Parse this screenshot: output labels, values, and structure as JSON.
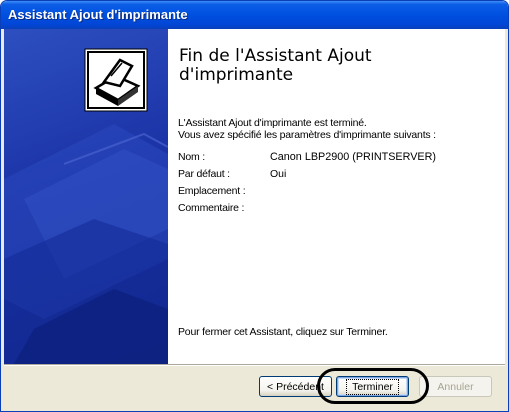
{
  "window": {
    "title": "Assistant Ajout d'imprimante"
  },
  "main": {
    "heading": "Fin de l'Assistant Ajout d'imprimante",
    "completed_line": "L'Assistant Ajout d'imprimante est terminé.",
    "specified_line": "Vous avez spécifié les paramètres d'imprimante suivants :",
    "fields": [
      {
        "label": "Nom :",
        "value": "Canon LBP2900 (PRINTSERVER)"
      },
      {
        "label": "Par défaut :",
        "value": "Oui"
      },
      {
        "label": "Emplacement :",
        "value": ""
      },
      {
        "label": "Commentaire :",
        "value": ""
      }
    ],
    "footer_text": "Pour fermer cet Assistant, cliquez sur Terminer."
  },
  "buttons": {
    "back_label": "< Précédent",
    "finish_label": "Terminer",
    "cancel_label": "Annuler"
  },
  "colors": {
    "title_bar": "#0050e0",
    "banner": "#1b33a6",
    "dialog_bg": "#ece9d8"
  }
}
